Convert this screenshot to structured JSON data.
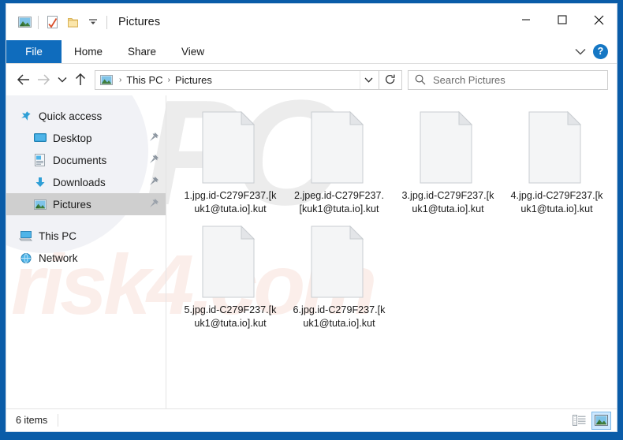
{
  "window": {
    "title": "Pictures",
    "quick_access_toolbar": [
      {
        "name": "pictures-icon",
        "label": "Pictures"
      },
      {
        "name": "properties-icon",
        "label": "Properties"
      },
      {
        "name": "new-folder-icon",
        "label": "New folder"
      },
      {
        "name": "customize-chevron-icon",
        "label": "Customize Quick Access Toolbar"
      }
    ],
    "controls": {
      "minimize": "─",
      "maximize": "☐",
      "close": "✕"
    }
  },
  "ribbon": {
    "tabs": [
      {
        "label": "File",
        "active": true
      },
      {
        "label": "Home",
        "active": false
      },
      {
        "label": "Share",
        "active": false
      },
      {
        "label": "View",
        "active": false
      }
    ],
    "collapse_label": "⌄",
    "help_label": "?"
  },
  "address_bar": {
    "back_label": "←",
    "forward_label": "→",
    "recent_label": "⌄",
    "up_label": "↑",
    "breadcrumbs": [
      "This PC",
      "Pictures"
    ],
    "breadcrumb_separator": "›",
    "dropdown_label": "⌄",
    "refresh_label": "↻"
  },
  "search": {
    "placeholder": "Search Pictures",
    "value": "",
    "icon": "search-icon"
  },
  "sidebar": {
    "items": [
      {
        "label": "Quick access",
        "icon": "pin-star-icon",
        "level": 0,
        "pinned": false,
        "selected": false
      },
      {
        "label": "Desktop",
        "icon": "desktop-icon",
        "level": 1,
        "pinned": true,
        "selected": false
      },
      {
        "label": "Documents",
        "icon": "documents-icon",
        "level": 1,
        "pinned": true,
        "selected": false
      },
      {
        "label": "Downloads",
        "icon": "downloads-icon",
        "level": 1,
        "pinned": true,
        "selected": false
      },
      {
        "label": "Pictures",
        "icon": "pictures-icon",
        "level": 1,
        "pinned": true,
        "selected": true
      },
      {
        "label": "This PC",
        "icon": "this-pc-icon",
        "level": 0,
        "pinned": false,
        "selected": false
      },
      {
        "label": "Network",
        "icon": "network-icon",
        "level": 0,
        "pinned": false,
        "selected": false
      }
    ]
  },
  "files": [
    {
      "name": "1.jpg.id-C279F237.[kuk1@tuta.io].kut",
      "icon": "blank-document-icon"
    },
    {
      "name": "2.jpeg.id-C279F237.[kuk1@tuta.io].kut",
      "icon": "blank-document-icon"
    },
    {
      "name": "3.jpg.id-C279F237.[kuk1@tuta.io].kut",
      "icon": "blank-document-icon"
    },
    {
      "name": "4.jpg.id-C279F237.[kuk1@tuta.io].kut",
      "icon": "blank-document-icon"
    },
    {
      "name": "5.jpg.id-C279F237.[kuk1@tuta.io].kut",
      "icon": "blank-document-icon"
    },
    {
      "name": "6.jpg.id-C279F237.[kuk1@tuta.io].kut",
      "icon": "blank-document-icon"
    }
  ],
  "status_bar": {
    "item_count_text": "6 items",
    "views": [
      {
        "name": "details-view-button",
        "active": false
      },
      {
        "name": "large-icons-view-button",
        "active": true
      }
    ]
  },
  "watermarks": {
    "top": "PC",
    "bottom": "risk4.com"
  },
  "colors": {
    "frame_blue": "#0A5CA8",
    "file_tab_blue": "#0f6cbd",
    "selection_gray": "#cfcfcf",
    "help_blue": "#1577c4",
    "view_active_blue": "#cde8ff"
  }
}
